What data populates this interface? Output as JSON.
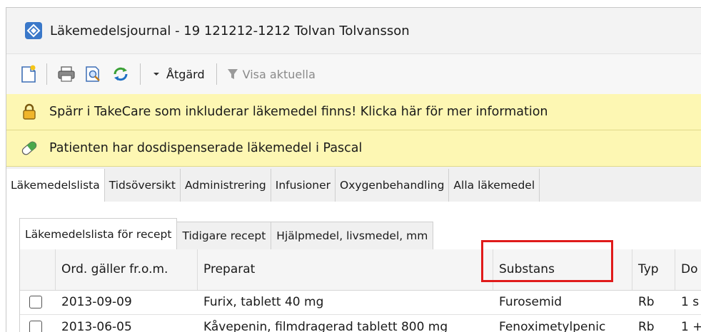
{
  "window": {
    "title": "Läkemedelsjournal - 19 121212-1212 Tolvan Tolvansson",
    "icon": "app-diamond-icon"
  },
  "toolbar": {
    "new_icon": "new-document-icon",
    "print_icon": "printer-icon",
    "preview_icon": "print-preview-icon",
    "refresh_icon": "refresh-icon",
    "action_label": "Åtgärd",
    "filter_label": "Visa aktuella"
  },
  "banners": [
    {
      "icon": "lock-icon",
      "text": "Spärr i TakeCare som inkluderar läkemedel finns! Klicka här för mer information"
    },
    {
      "icon": "pill-icon",
      "text": "Patienten har dosdispenserade läkemedel i Pascal"
    }
  ],
  "main_tabs": [
    {
      "label": "Läkemedelslista",
      "active": true
    },
    {
      "label": "Tidsöversikt"
    },
    {
      "label": "Administrering"
    },
    {
      "label": "Infusioner"
    },
    {
      "label": "Oxygenbehandling"
    },
    {
      "label": "Alla läkemedel"
    }
  ],
  "sub_tabs": [
    {
      "label": "Läkemedelslista för recept",
      "active": true
    },
    {
      "label": "Tidigare recept"
    },
    {
      "label": "Hjälpmedel, livsmedel, mm"
    }
  ],
  "table": {
    "columns": [
      "Ord. gäller fr.o.m.",
      "Preparat",
      "Substans",
      "Typ",
      "Do"
    ],
    "rows": [
      [
        "2013-09-09",
        "Furix, tablett 40 mg",
        "Furosemid",
        "Rb",
        "1 s"
      ],
      [
        "2013-06-05",
        "Kåvepenin, filmdragerad tablett 800 mg",
        "Fenoximetylpenic",
        "Rb",
        "1 +"
      ]
    ],
    "highlighted_column": "Substans"
  },
  "colors": {
    "banner_bg": "#fdf7b3",
    "highlight": "#e01b1b",
    "tab_bg": "#f0f0f0"
  }
}
